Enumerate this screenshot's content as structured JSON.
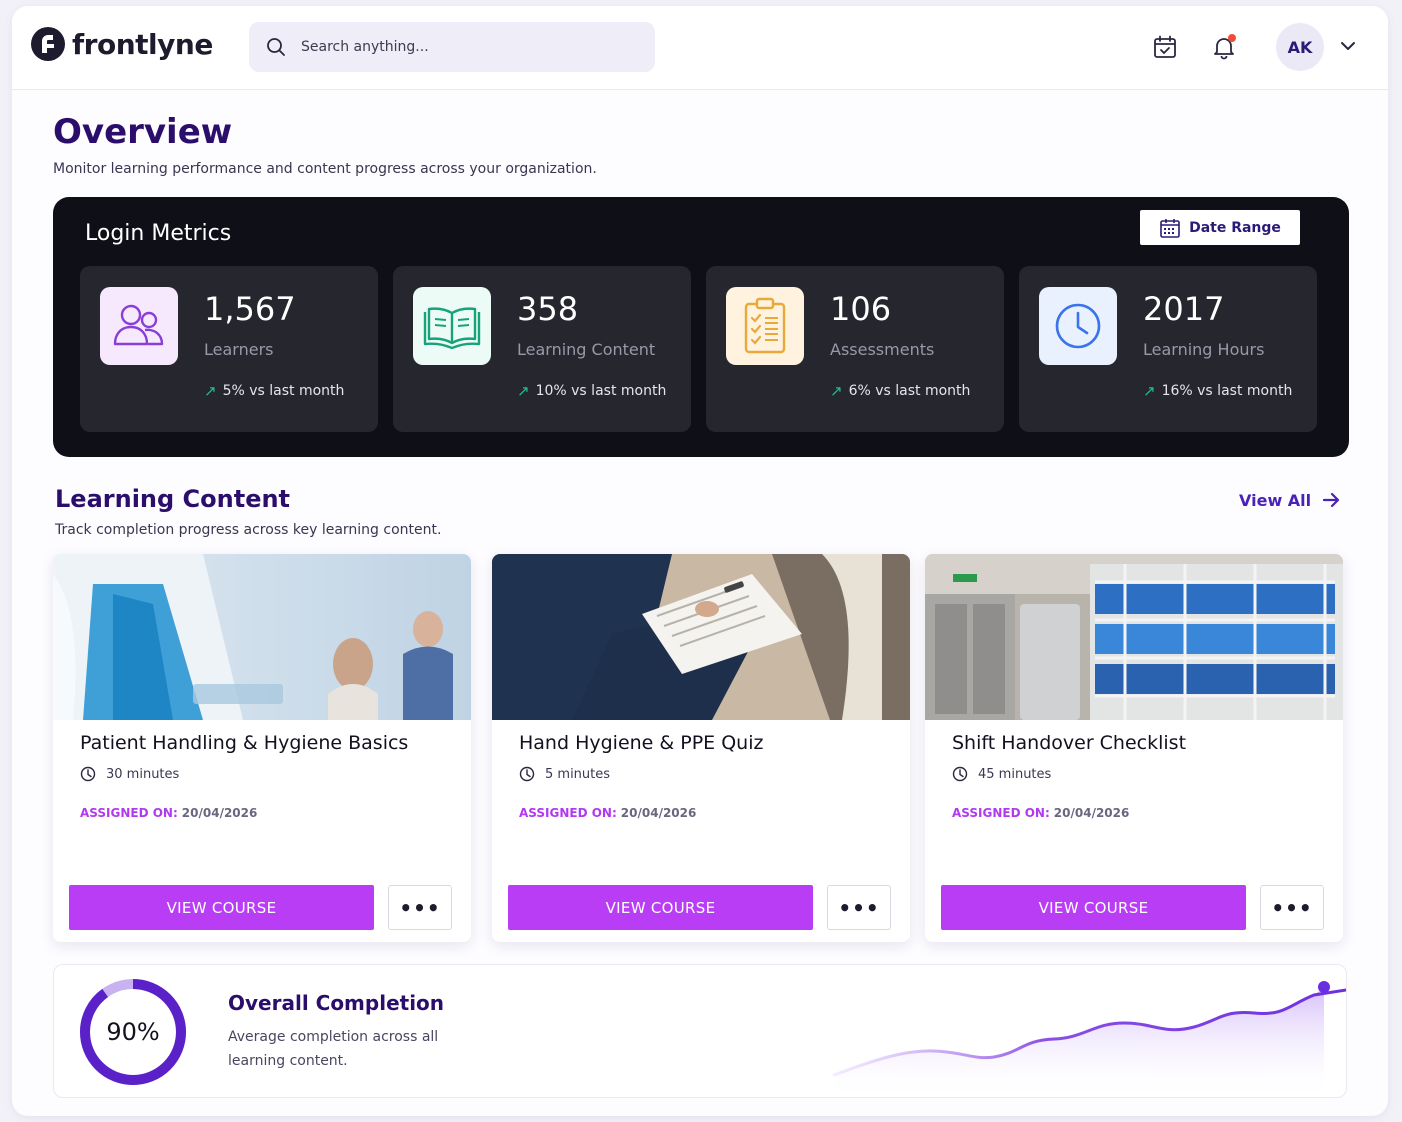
{
  "header": {
    "logo_text": "frontlyne",
    "search_placeholder": "Search anything...",
    "avatar_initials": "AK"
  },
  "overview": {
    "title": "Overview",
    "subtitle": "Monitor learning performance and content progress across your organization."
  },
  "metrics": {
    "title": "Login Metrics",
    "date_range_label": "Date Range",
    "cards": [
      {
        "value": "1,567",
        "label": "Learners",
        "trend": "5% vs last month",
        "icon": "users-icon",
        "icon_bg": "#f7e9fd",
        "icon_color": "#8a3ed8"
      },
      {
        "value": "358",
        "label": "Learning Content",
        "trend": "10% vs last month",
        "icon": "book-icon",
        "icon_bg": "#ecfbf5",
        "icon_color": "#17a37a"
      },
      {
        "value": "106",
        "label": "Assessments",
        "trend": "6% vs last month",
        "icon": "clipboard-icon",
        "icon_bg": "#fff3df",
        "icon_color": "#e9a93a"
      },
      {
        "value": "2017",
        "label": "Learning Hours",
        "trend": "16% vs last month",
        "icon": "clock-icon",
        "icon_bg": "#e9f1ff",
        "icon_color": "#3b74e8"
      }
    ]
  },
  "learning_content": {
    "title": "Learning Content",
    "subtitle": "Track completion progress across key learning content.",
    "view_all": "View All",
    "courses": [
      {
        "title": "Patient Handling & Hygiene Basics",
        "duration": "30 minutes",
        "assigned_label": "ASSIGNED ON:",
        "assigned_date": "20/04/2026",
        "button": "VIEW COURSE",
        "more": "•••"
      },
      {
        "title": "Hand Hygiene & PPE Quiz",
        "duration": "5 minutes",
        "assigned_label": "ASSIGNED ON:",
        "assigned_date": "20/04/2026",
        "button": "VIEW COURSE",
        "more": "•••"
      },
      {
        "title": "Shift Handover Checklist",
        "duration": "45 minutes",
        "assigned_label": "ASSIGNED ON:",
        "assigned_date": "20/04/2026",
        "button": "VIEW COURSE",
        "more": "•••"
      }
    ]
  },
  "completion": {
    "title": "Overall Completion",
    "subtitle": "Average completion across all learning content.",
    "value_text": "90%",
    "progress": 0.9,
    "accent": "#5b21c8"
  },
  "colors": {
    "brand": "#2b0e6b",
    "primary_button": "#b83df5",
    "trend_up": "#1fc08a"
  }
}
